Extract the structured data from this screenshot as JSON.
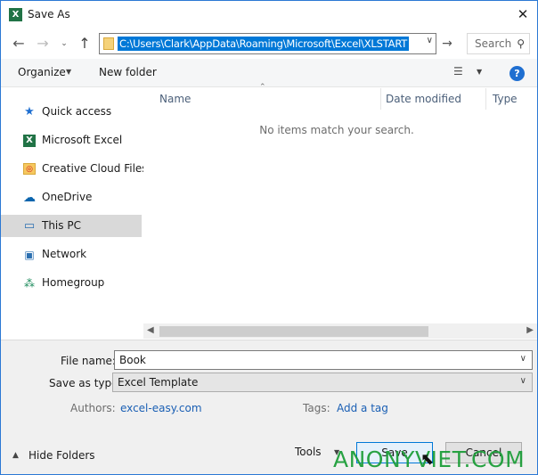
{
  "window": {
    "title": "Save As",
    "title_icon": "X"
  },
  "address": {
    "path": "C:\\Users\\Clark\\AppData\\Roaming\\Microsoft\\Excel\\XLSTART",
    "search_placeholder": "Search"
  },
  "toolbar": {
    "organize": "Organize",
    "new_folder": "New folder",
    "help": "?"
  },
  "navpane": {
    "items": [
      {
        "label": "Quick access",
        "icon": "star-icon"
      },
      {
        "label": "Microsoft Excel",
        "icon": "excel-icon"
      },
      {
        "label": "Creative Cloud Files",
        "icon": "creative-cloud-icon"
      },
      {
        "label": "OneDrive",
        "icon": "cloud-icon"
      },
      {
        "label": "This PC",
        "icon": "computer-icon",
        "selected": true
      },
      {
        "label": "Network",
        "icon": "network-icon"
      },
      {
        "label": "Homegroup",
        "icon": "homegroup-icon"
      }
    ]
  },
  "files": {
    "columns": [
      "Name",
      "Date modified",
      "Type"
    ],
    "empty_message": "No items match your search."
  },
  "form": {
    "file_name_label": "File name:",
    "file_name_value": "Book",
    "save_type_label": "Save as type:",
    "save_type_value": "Excel Template",
    "authors_label": "Authors:",
    "authors_value": "excel-easy.com",
    "tags_label": "Tags:",
    "tags_value": "Add a tag"
  },
  "footer": {
    "hide_folders": "Hide Folders",
    "tools": "Tools",
    "save": "Save",
    "cancel": "Cancel"
  },
  "watermark": "ANONYVIET.COM",
  "colors": {
    "accent": "#0078d7",
    "excel_green": "#217346",
    "watermark": "#1e9e3a"
  }
}
